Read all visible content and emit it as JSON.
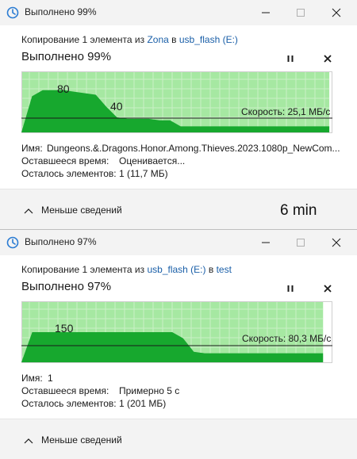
{
  "colors": {
    "graph_fill_light": "#a6e8a2",
    "graph_fill_dark": "#17a82e",
    "graph_grid": "#c9f0c6",
    "link": "#1a5fa8",
    "titlebar_bg": "#f3f3f3"
  },
  "icons": {
    "app": "file-explorer-progress-icon",
    "minimize": "minimize-icon",
    "maximize": "maximize-icon",
    "close": "close-icon",
    "pause": "pause-icon",
    "cancel": "cancel-icon",
    "collapse": "chevron-up-icon"
  },
  "dialog1": {
    "title": "Выполнено 99%",
    "copy": {
      "prefix": "Копирование 1 элемента из ",
      "source": "Zona",
      "middle": " в ",
      "dest": "usb_flash (E:)"
    },
    "percent_text": "Выполнено 99%",
    "progress": 0.99,
    "speed_label": "Скорость: 25,1 МБ/с",
    "peak_labels": [
      "80",
      "40"
    ],
    "details": [
      {
        "label": "Имя:",
        "value": "Dungeons.&.Dragons.Honor.Among.Thieves.2023.1080p_NewCom..."
      },
      {
        "label": "Оставшееся время:",
        "value": "Оцениваетcя..."
      },
      {
        "label": "Осталось элементов:",
        "value": "1 (11,7 МБ)"
      }
    ],
    "less_details": "Меньше сведений",
    "overlay_note": "6 min",
    "chart_data": {
      "type": "area",
      "speed_series": [
        0,
        24,
        28,
        28,
        28,
        27,
        26,
        25,
        17,
        10,
        9,
        9,
        9,
        8,
        8,
        4,
        4,
        4,
        4,
        4,
        4,
        4,
        4,
        4,
        4,
        4,
        4,
        4,
        4,
        4
      ],
      "current_speed": "25,1 МБ/с"
    }
  },
  "dialog2": {
    "title": "Выполнено 97%",
    "copy": {
      "prefix": "Копирование 1 элемента из ",
      "source": "usb_flash (E:)",
      "middle": " в ",
      "dest": "test"
    },
    "percent_text": "Выполнено 97%",
    "progress": 0.97,
    "speed_label": "Скорость: 80,3 МБ/с",
    "peak_labels": [
      "150"
    ],
    "details": [
      {
        "label": "Имя:",
        "value": "1"
      },
      {
        "label": "Оставшееся время:",
        "value": "Примерно 5 с"
      },
      {
        "label": "Осталось элементов:",
        "value": "1 (201 МБ)"
      }
    ],
    "less_details": "Меньше сведений",
    "chart_data": {
      "type": "area",
      "speed_series": [
        0,
        20,
        20,
        20,
        20,
        20,
        20,
        20,
        20,
        20,
        20,
        20,
        20,
        20,
        20,
        16,
        7,
        6,
        6,
        6,
        6,
        6,
        6,
        6,
        6,
        6,
        6,
        6,
        6
      ],
      "current_speed": "80,3 МБ/с"
    }
  }
}
